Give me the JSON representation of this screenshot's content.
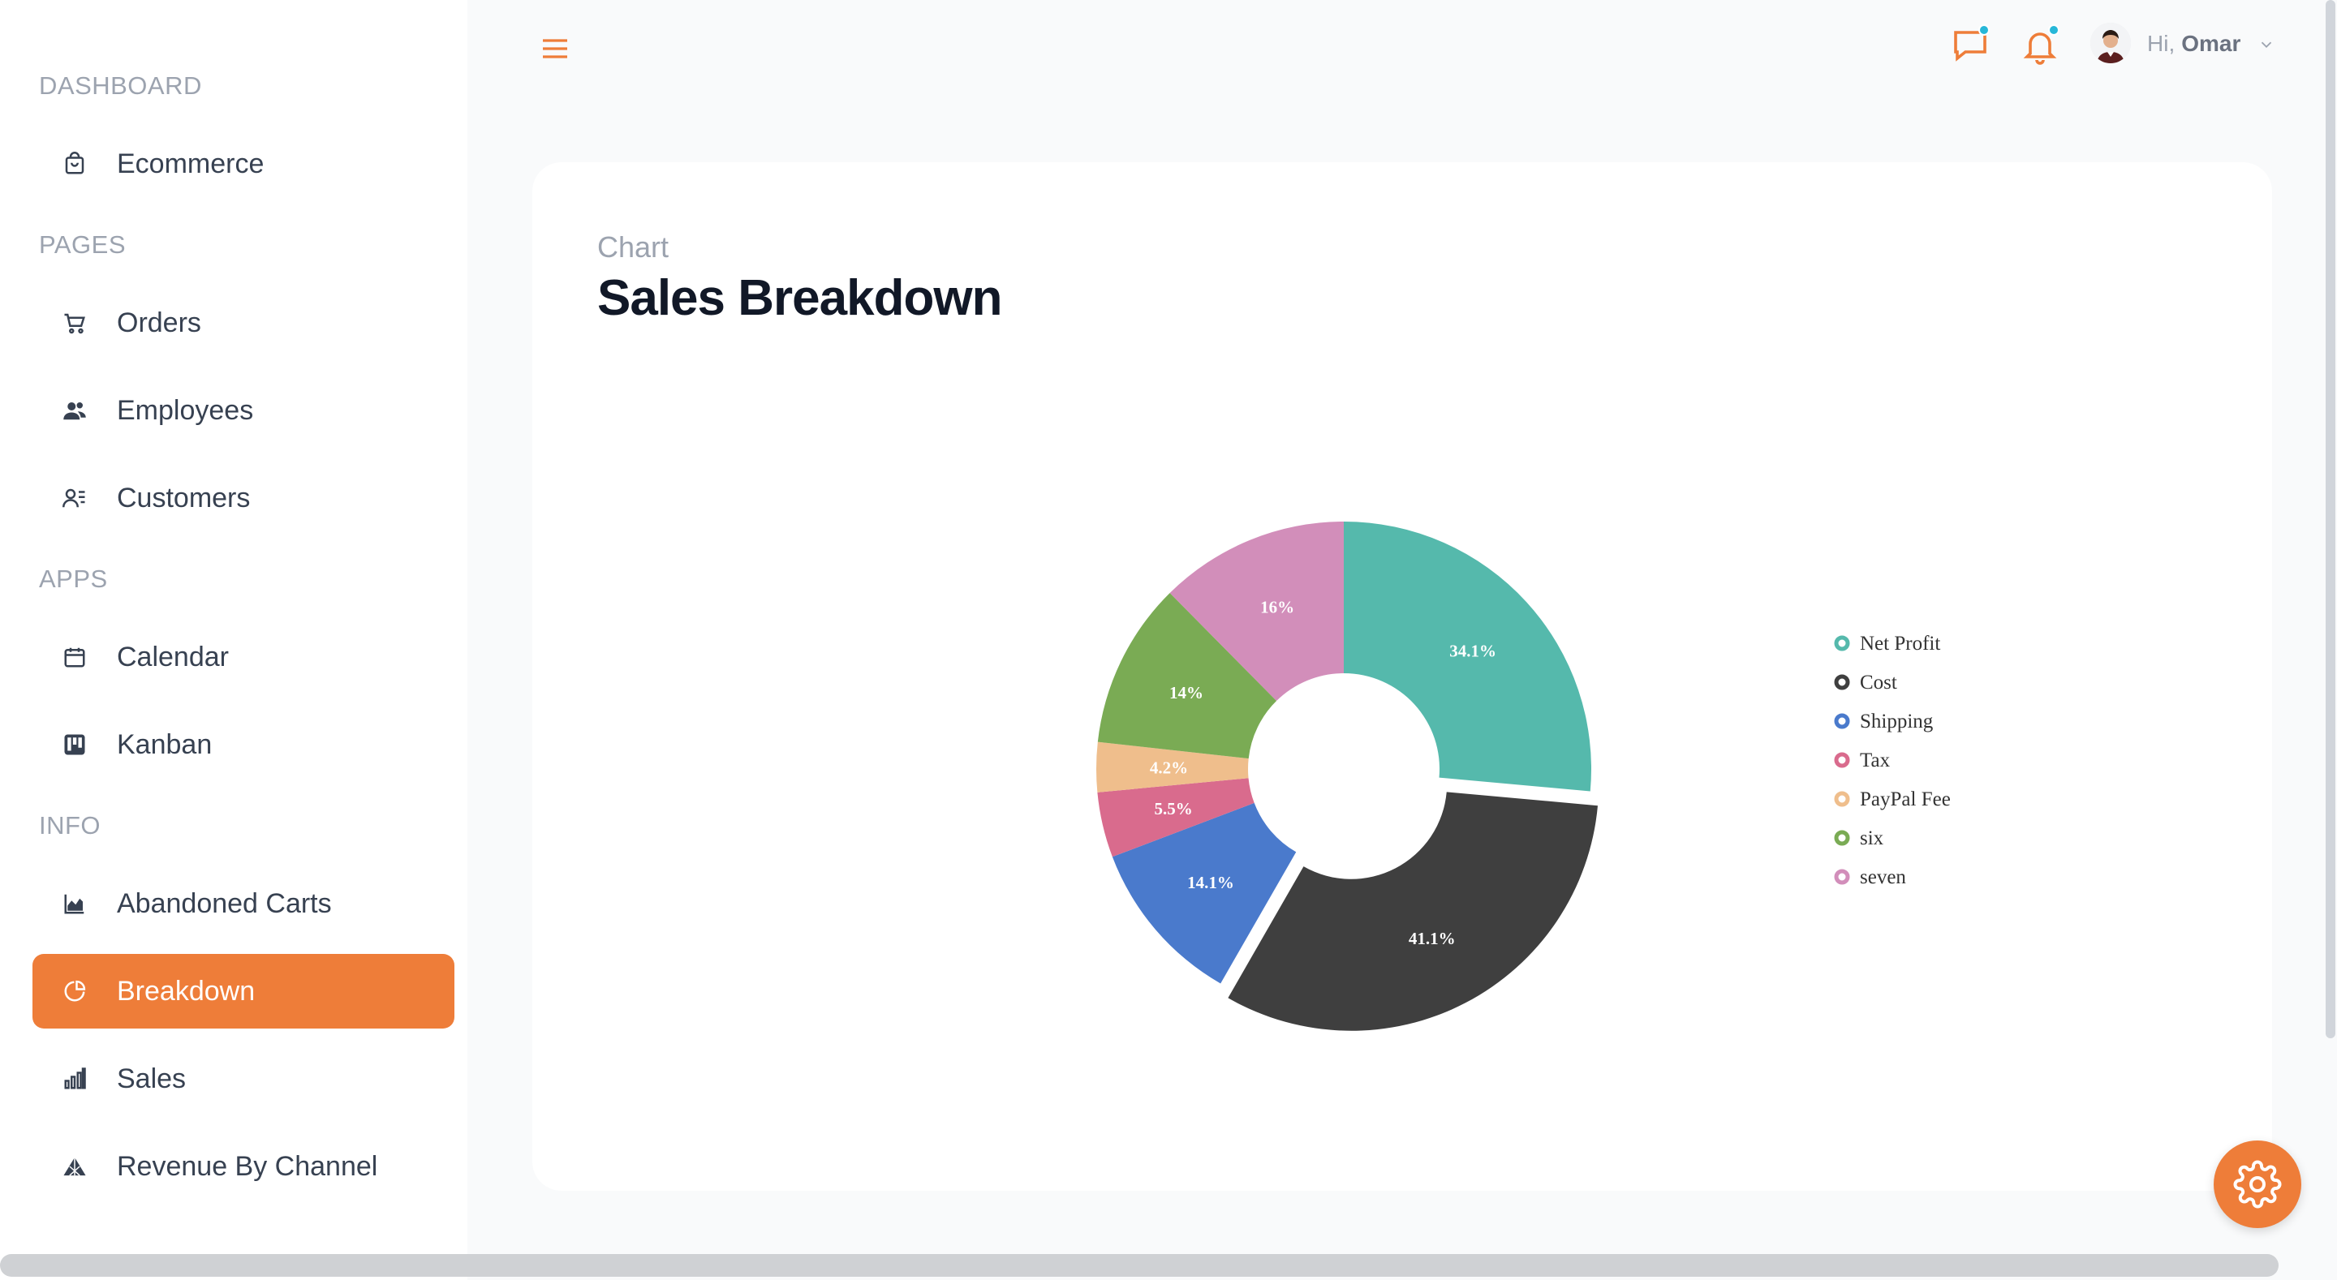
{
  "colors": {
    "accent": "#ee7d39",
    "notification_dot": "#27b7d8"
  },
  "sidebar": {
    "sections": [
      {
        "title": "DASHBOARD",
        "items": [
          {
            "label": "Ecommerce",
            "icon": "shopping-bag-icon"
          }
        ]
      },
      {
        "title": "PAGES",
        "items": [
          {
            "label": "Orders",
            "icon": "cart-icon"
          },
          {
            "label": "Employees",
            "icon": "users-icon"
          },
          {
            "label": "Customers",
            "icon": "user-list-icon"
          }
        ]
      },
      {
        "title": "APPS",
        "items": [
          {
            "label": "Calendar",
            "icon": "calendar-icon"
          },
          {
            "label": "Kanban",
            "icon": "kanban-icon"
          }
        ]
      },
      {
        "title": "INFO",
        "items": [
          {
            "label": "Abandoned Carts",
            "icon": "area-chart-icon"
          },
          {
            "label": "Breakdown",
            "icon": "pie-chart-icon",
            "active": true
          },
          {
            "label": "Sales",
            "icon": "bar-chart-icon"
          },
          {
            "label": "Revenue By Channel",
            "icon": "pyramid-icon"
          }
        ]
      }
    ]
  },
  "topbar": {
    "greeting": "Hi,",
    "user_name": "Omar"
  },
  "main": {
    "kicker": "Chart",
    "title": "Sales Breakdown"
  },
  "chart_data": {
    "type": "pie",
    "variant": "donut",
    "exploded": "Cost",
    "legend_position": "right",
    "categories": [
      "Net Profit",
      "Cost",
      "Shipping",
      "Tax",
      "PayPal Fee",
      "six",
      "seven"
    ],
    "values": [
      34.1,
      41.1,
      14.1,
      5.5,
      4.2,
      14,
      16
    ],
    "labels": [
      "34.1%",
      "41.1%",
      "14.1%",
      "5.5%",
      "4.2%",
      "14%",
      "16%"
    ],
    "colors": [
      "#55b9ac",
      "#3f3f3f",
      "#4a7acc",
      "#d96b8d",
      "#efbe8c",
      "#7aab54",
      "#d28eba"
    ]
  }
}
